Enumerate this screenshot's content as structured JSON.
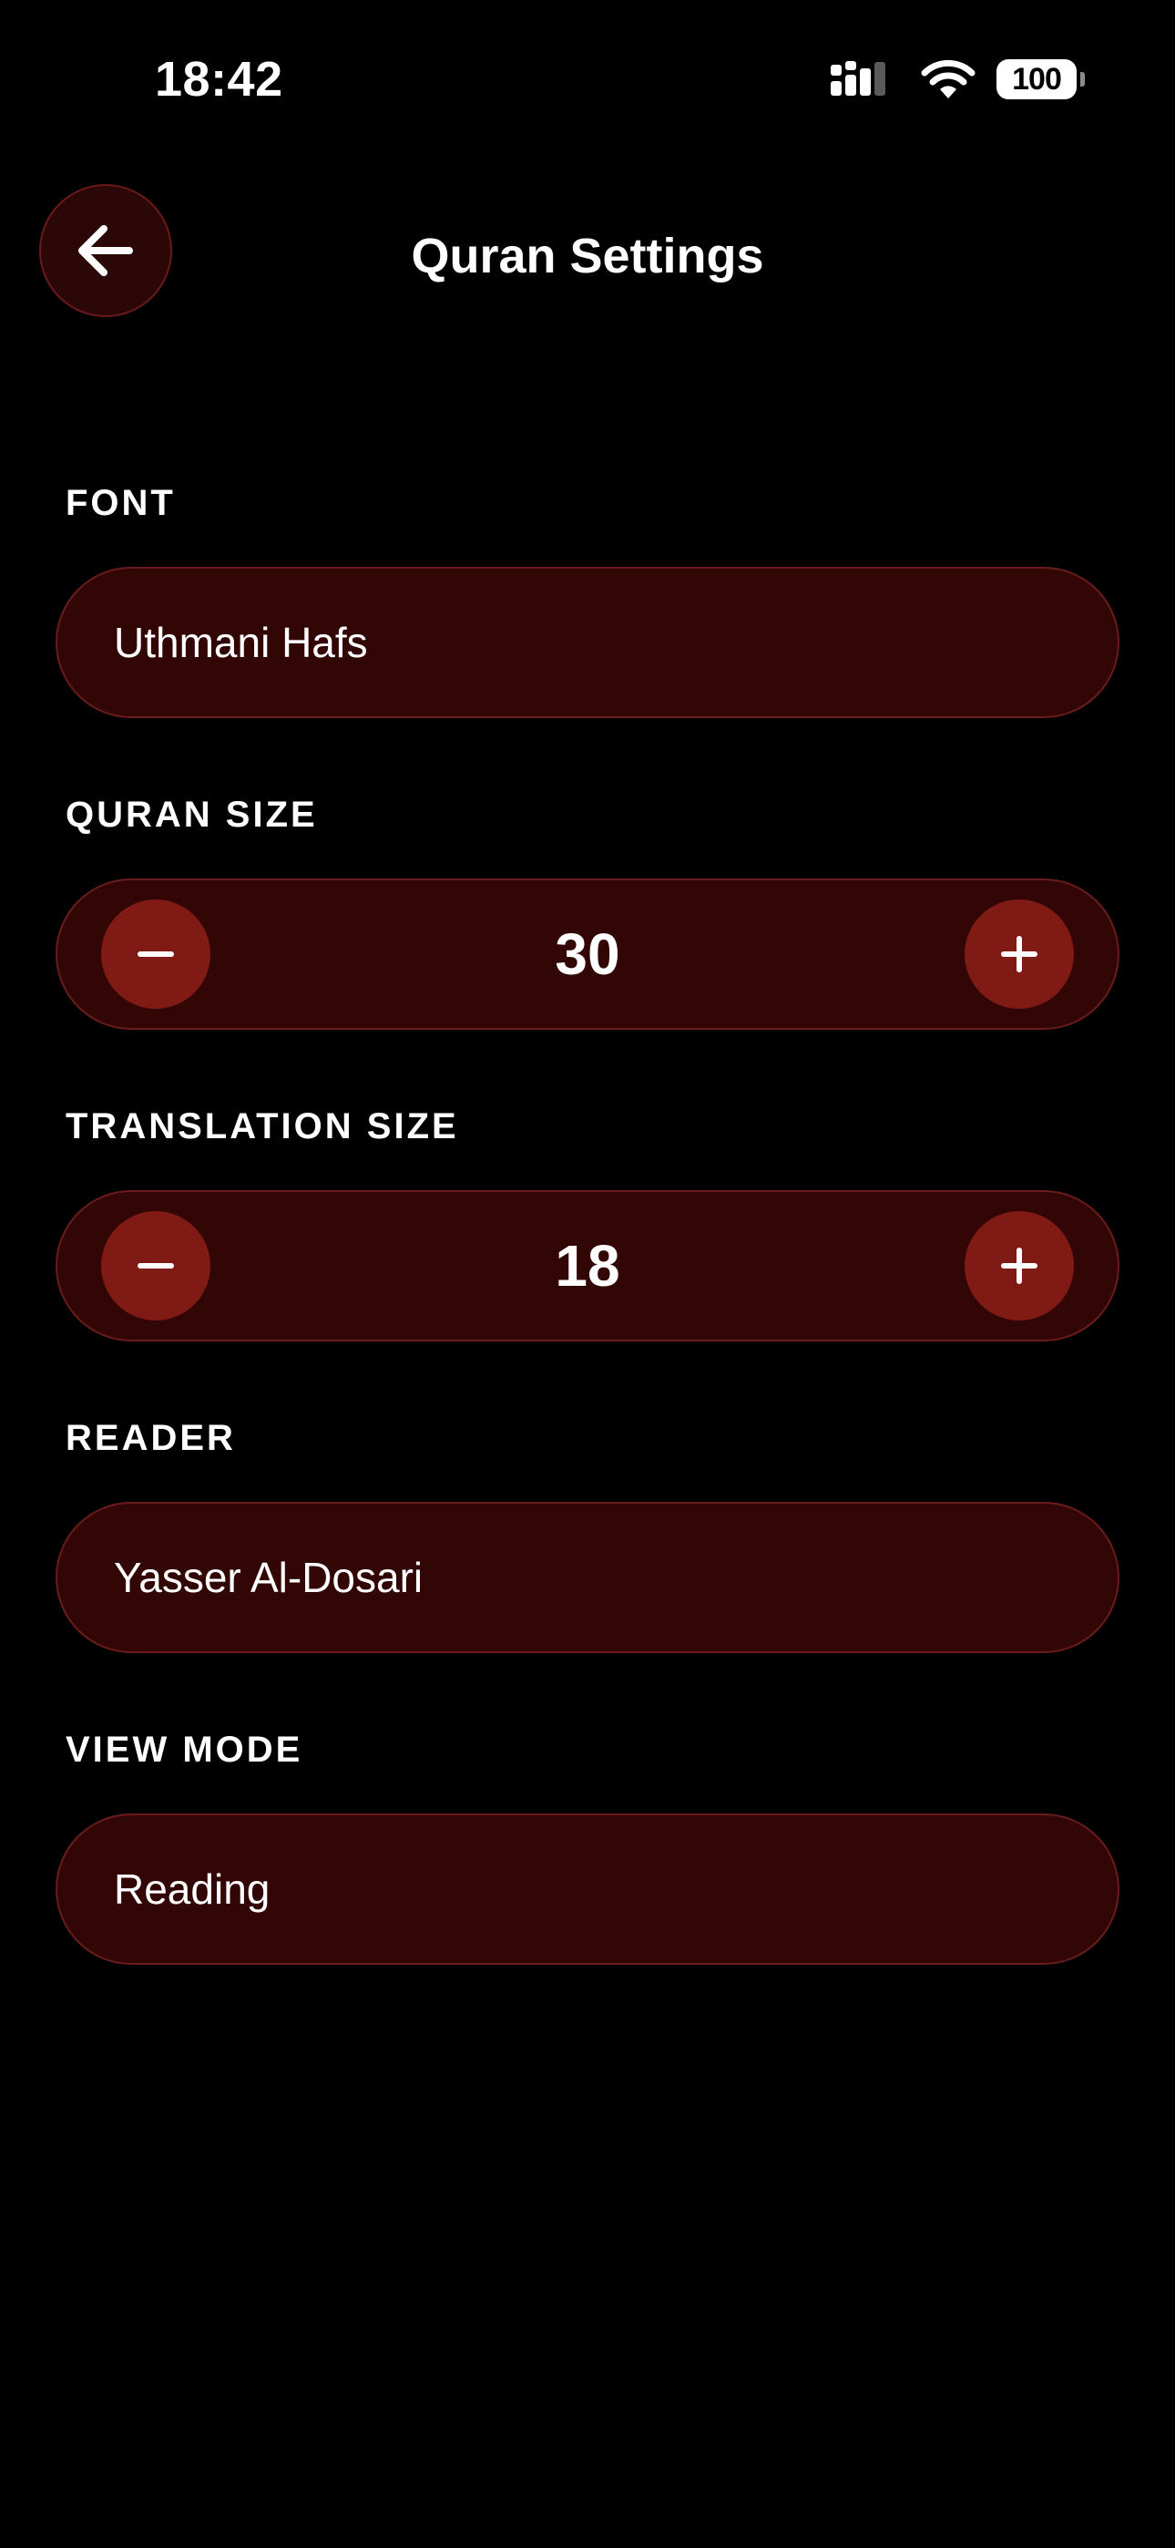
{
  "status_bar": {
    "time": "18:42",
    "battery": "100",
    "icons": [
      "signal-icon",
      "wifi-icon",
      "battery-icon"
    ]
  },
  "header": {
    "title": "Quran Settings",
    "back_icon": "arrow-left-icon"
  },
  "settings": {
    "font": {
      "label": "FONT",
      "value": "Uthmani Hafs"
    },
    "quran_size": {
      "label": "QURAN SIZE",
      "value": "30",
      "decrement_icon": "minus-icon",
      "increment_icon": "plus-icon"
    },
    "translation_size": {
      "label": "TRANSLATION SIZE",
      "value": "18",
      "decrement_icon": "minus-icon",
      "increment_icon": "plus-icon"
    },
    "reader": {
      "label": "READER",
      "value": "Yasser Al-Dosari"
    },
    "view_mode": {
      "label": "VIEW MODE",
      "value": "Reading"
    }
  },
  "colors": {
    "background": "#000000",
    "pill_background": "#330606",
    "pill_border": "#6a1c1c",
    "accent_button": "#7f1a14",
    "text": "#ffffff"
  }
}
